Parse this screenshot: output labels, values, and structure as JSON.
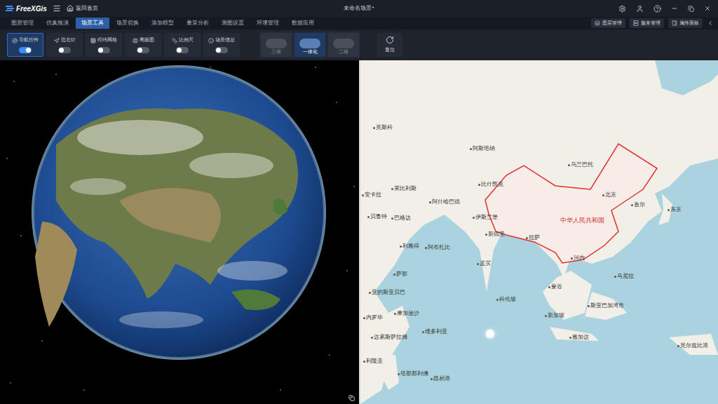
{
  "app": {
    "logo": "FreeXGis",
    "home": "返回首页",
    "title": "未命名场景*"
  },
  "menu": [
    {
      "label": "图层管理",
      "selected": false
    },
    {
      "label": "仿真推演",
      "selected": false
    },
    {
      "label": "场景工具",
      "selected": true
    },
    {
      "label": "场景切换",
      "selected": false
    },
    {
      "label": "添加模型",
      "selected": false
    },
    {
      "label": "量算分析",
      "selected": false
    },
    {
      "label": "测图设置",
      "selected": false
    },
    {
      "label": "环境管理",
      "selected": false
    },
    {
      "label": "数据应用",
      "selected": false
    }
  ],
  "right_buttons": [
    {
      "label": "图层管理"
    },
    {
      "label": "服务管理"
    },
    {
      "label": "属性面板"
    }
  ],
  "tools": [
    {
      "label": "导航控件",
      "on": true,
      "selected": true
    },
    {
      "label": "指北针",
      "on": false,
      "selected": false
    },
    {
      "label": "经纬网格",
      "on": false,
      "selected": false
    },
    {
      "label": "鹰眼图",
      "on": false,
      "selected": false
    },
    {
      "label": "比例尺",
      "on": false,
      "selected": false
    },
    {
      "label": "场景信息",
      "on": false,
      "selected": false
    }
  ],
  "view_modes": [
    {
      "label": "三维",
      "selected": false
    },
    {
      "label": "一体化",
      "selected": true
    },
    {
      "label": "二维",
      "selected": false
    }
  ],
  "reset": "复位",
  "map": {
    "country": "中华人民共和国",
    "places": [
      {
        "name": "莫斯科"
      },
      {
        "name": "阿斯塔纳"
      },
      {
        "name": "乌兰巴托"
      },
      {
        "name": "第比利斯"
      },
      {
        "name": "比什凯克"
      },
      {
        "name": "安卡拉"
      },
      {
        "name": "阿什哈巴德"
      },
      {
        "name": "伊斯兰堡"
      },
      {
        "name": "贝鲁特"
      },
      {
        "name": "巴格达"
      },
      {
        "name": "北京"
      },
      {
        "name": "首尔"
      },
      {
        "name": "东京"
      },
      {
        "name": "新德里"
      },
      {
        "name": "拉萨"
      },
      {
        "name": "利雅得"
      },
      {
        "name": "阿布扎比"
      },
      {
        "name": "孟买"
      },
      {
        "name": "河内"
      },
      {
        "name": "萨那"
      },
      {
        "name": "科伦坡"
      },
      {
        "name": "曼谷"
      },
      {
        "name": "马尼拉"
      },
      {
        "name": "亚的斯亚贝巴"
      },
      {
        "name": "摩加迪沙"
      },
      {
        "name": "新加坡"
      },
      {
        "name": "斯里巴加湾市"
      },
      {
        "name": "内罗毕"
      },
      {
        "name": "维多利亚"
      },
      {
        "name": "达累斯萨拉姆"
      },
      {
        "name": "雅加达"
      },
      {
        "name": "莫尔兹比港"
      },
      {
        "name": "利隆圭"
      },
      {
        "name": "塔那那利佛"
      },
      {
        "name": "路易港"
      }
    ]
  }
}
